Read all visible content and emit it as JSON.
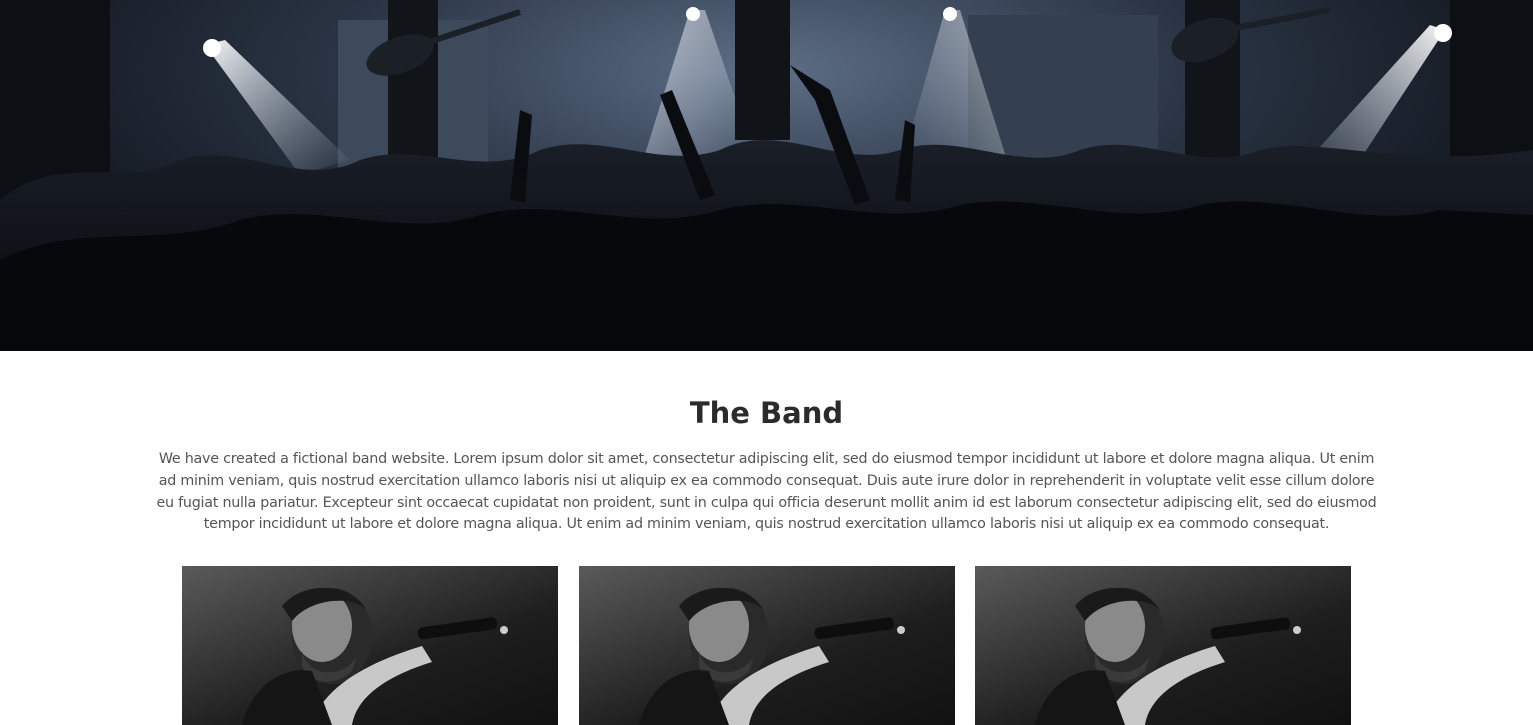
{
  "hero": {
    "image": "concert-crowd-stage-lights"
  },
  "band": {
    "title": "The Band",
    "description": "We have created a fictional band website. Lorem ipsum dolor sit amet, consectetur adipiscing elit, sed do eiusmod tempor incididunt ut labore et dolore magna aliqua. Ut enim ad minim veniam, quis nostrud exercitation ullamco laboris nisi ut aliquip ex ea commodo consequat. Duis aute irure dolor in reprehenderit in voluptate velit esse cillum dolore eu fugiat nulla pariatur. Excepteur sint occaecat cupidatat non proident, sunt in culpa qui officia deserunt mollit anim id est laborum consectetur adipiscing elit, sed do eiusmod tempor incididunt ut labore et dolore magna aliqua. Ut enim ad minim veniam, quis nostrud exercitation ullamco laboris nisi ut aliquip ex ea commodo consequat."
  },
  "gallery": {
    "photos": [
      {
        "image": "singer-with-microphone"
      },
      {
        "image": "singer-with-microphone"
      },
      {
        "image": "singer-with-microphone"
      }
    ]
  }
}
